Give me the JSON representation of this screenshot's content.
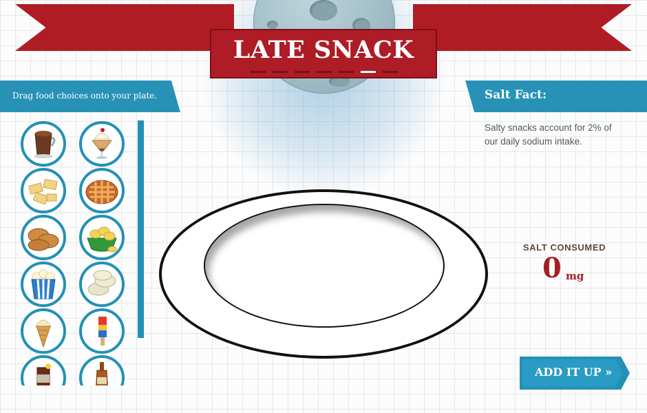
{
  "header": {
    "title": "LATE SNACK",
    "steps": {
      "total": 7,
      "current": 6
    }
  },
  "instructions": "Drag food choices onto your plate.",
  "salt_fact": {
    "heading": "Salt Fact:",
    "body": "Salty snacks account for 2% of our daily sodium intake."
  },
  "salt_counter": {
    "label": "SALT CONSUMED",
    "value": "0",
    "unit": "mg"
  },
  "add_button": {
    "label": "ADD IT UP »"
  },
  "foods": [
    {
      "icon": "hot-chocolate-icon"
    },
    {
      "icon": "ice-cream-sundae-icon"
    },
    {
      "icon": "cheese-crackers-icon"
    },
    {
      "icon": "pie-icon"
    },
    {
      "icon": "cookies-icon"
    },
    {
      "icon": "potato-chips-icon"
    },
    {
      "icon": "popcorn-icon"
    },
    {
      "icon": "rice-cakes-icon"
    },
    {
      "icon": "ice-cream-cone-icon"
    },
    {
      "icon": "popsicle-icon"
    },
    {
      "icon": "bottle-icon"
    },
    {
      "icon": "root-beer-icon"
    }
  ],
  "colors": {
    "banner_red": "#b01c24",
    "accent_blue": "#2490b6",
    "salt_red": "#a51e25"
  }
}
